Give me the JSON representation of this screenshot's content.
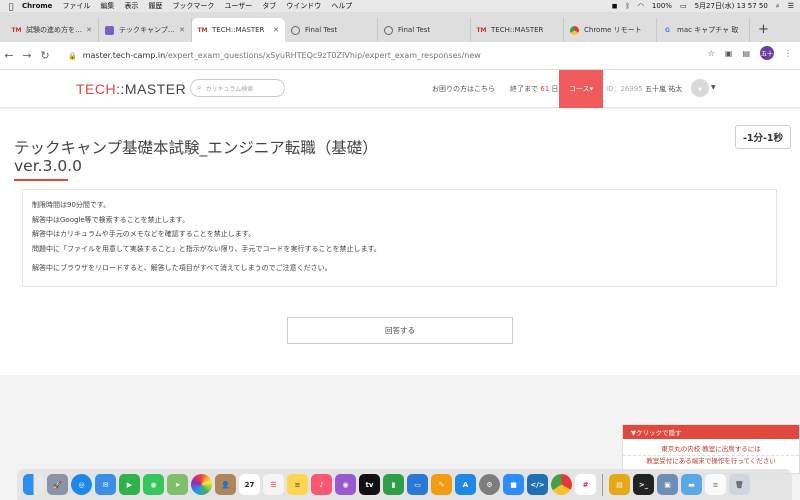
{
  "menubar": {
    "app": "Chrome",
    "items": [
      "ファイル",
      "編集",
      "表示",
      "履歴",
      "ブックマーク",
      "ユーザー",
      "タブ",
      "ウインドウ",
      "ヘルプ"
    ],
    "battery": "100%",
    "datetime": "5月27日(水)  13 57 50"
  },
  "tabs": [
    {
      "title": "試験の進め方を学ぼ",
      "icon": "techmaster-favicon"
    },
    {
      "title": "テックキャンプ エン",
      "icon": "purple-favicon"
    },
    {
      "title": "TECH::MASTER",
      "icon": "techmaster-favicon"
    },
    {
      "title": "Final Test",
      "icon": "globe-favicon"
    },
    {
      "title": "Final Test",
      "icon": "globe-favicon"
    },
    {
      "title": "TECH::MASTER",
      "icon": "techmaster-favicon"
    },
    {
      "title": "Chrome リモート",
      "icon": "chrome-favicon"
    },
    {
      "title": "mac キャプチャ 取",
      "icon": "google-favicon"
    }
  ],
  "address": {
    "host": "master.tech-camp.in",
    "path": "/expert_exam_questions/xSyuRHTEQc9zT0ZIVhip/expert_exam_responses/new"
  },
  "toolbar": {
    "profile_label": "五十"
  },
  "site": {
    "logo_tech": "TECH",
    "logo_sep": "::",
    "logo_master": "MASTER",
    "search_placeholder": "カリキュラム検索",
    "help": "お困りの方はこちら",
    "remain_prefix": "終了まで",
    "remain_days": "61",
    "remain_suffix": "日",
    "course": "コース▾",
    "uid_prefix": "ID：26995",
    "user_name": "五十嵐 祐太"
  },
  "main": {
    "title": "テックキャンプ基礎本試験_エンジニア転職（基礎）ver.3.0.0",
    "timer": "-1分-1秒",
    "rules": [
      "制限時間は90分間です。",
      "解答中はGoogle等で検索することを禁止します。",
      "解答中はカリキュラムや手元のメモなどを確認することを禁止します。",
      "問題中に「ファイルを用意して実装すること」と指示がない限り、手元でコードを実行することを禁止します。"
    ],
    "rule_note": "解答中にブラウザをリロードすると、解答した項目がすべて消えてしまうのでご注意ください。",
    "answer_button": "回答する"
  },
  "chat": {
    "header": "▼クリックで隠す",
    "line1": "東京丸の内校 教室に出席するには",
    "line2": "教室受付にある端末で操作を行ってください"
  },
  "dock": {
    "icons": [
      "finder-icon",
      "launchpad-icon",
      "safari-icon",
      "mail-icon",
      "facetime-icon",
      "messages-icon",
      "maps-icon",
      "photos-icon",
      "contacts-icon",
      "calendar-icon",
      "reminders-icon",
      "notes-icon",
      "music-icon",
      "podcasts-icon",
      "appletv-icon",
      "numbers-icon",
      "keynote-icon",
      "pages-icon",
      "appstore-icon",
      "systemprefs-icon",
      "zoom-icon",
      "vscode-icon",
      "chrome-icon",
      "slack-icon",
      "sequel-icon",
      "terminal-icon",
      "preview-icon",
      "folder-icon",
      "document-icon",
      "trash-icon"
    ],
    "calendar_day": "27",
    "tv_label": "tv"
  }
}
